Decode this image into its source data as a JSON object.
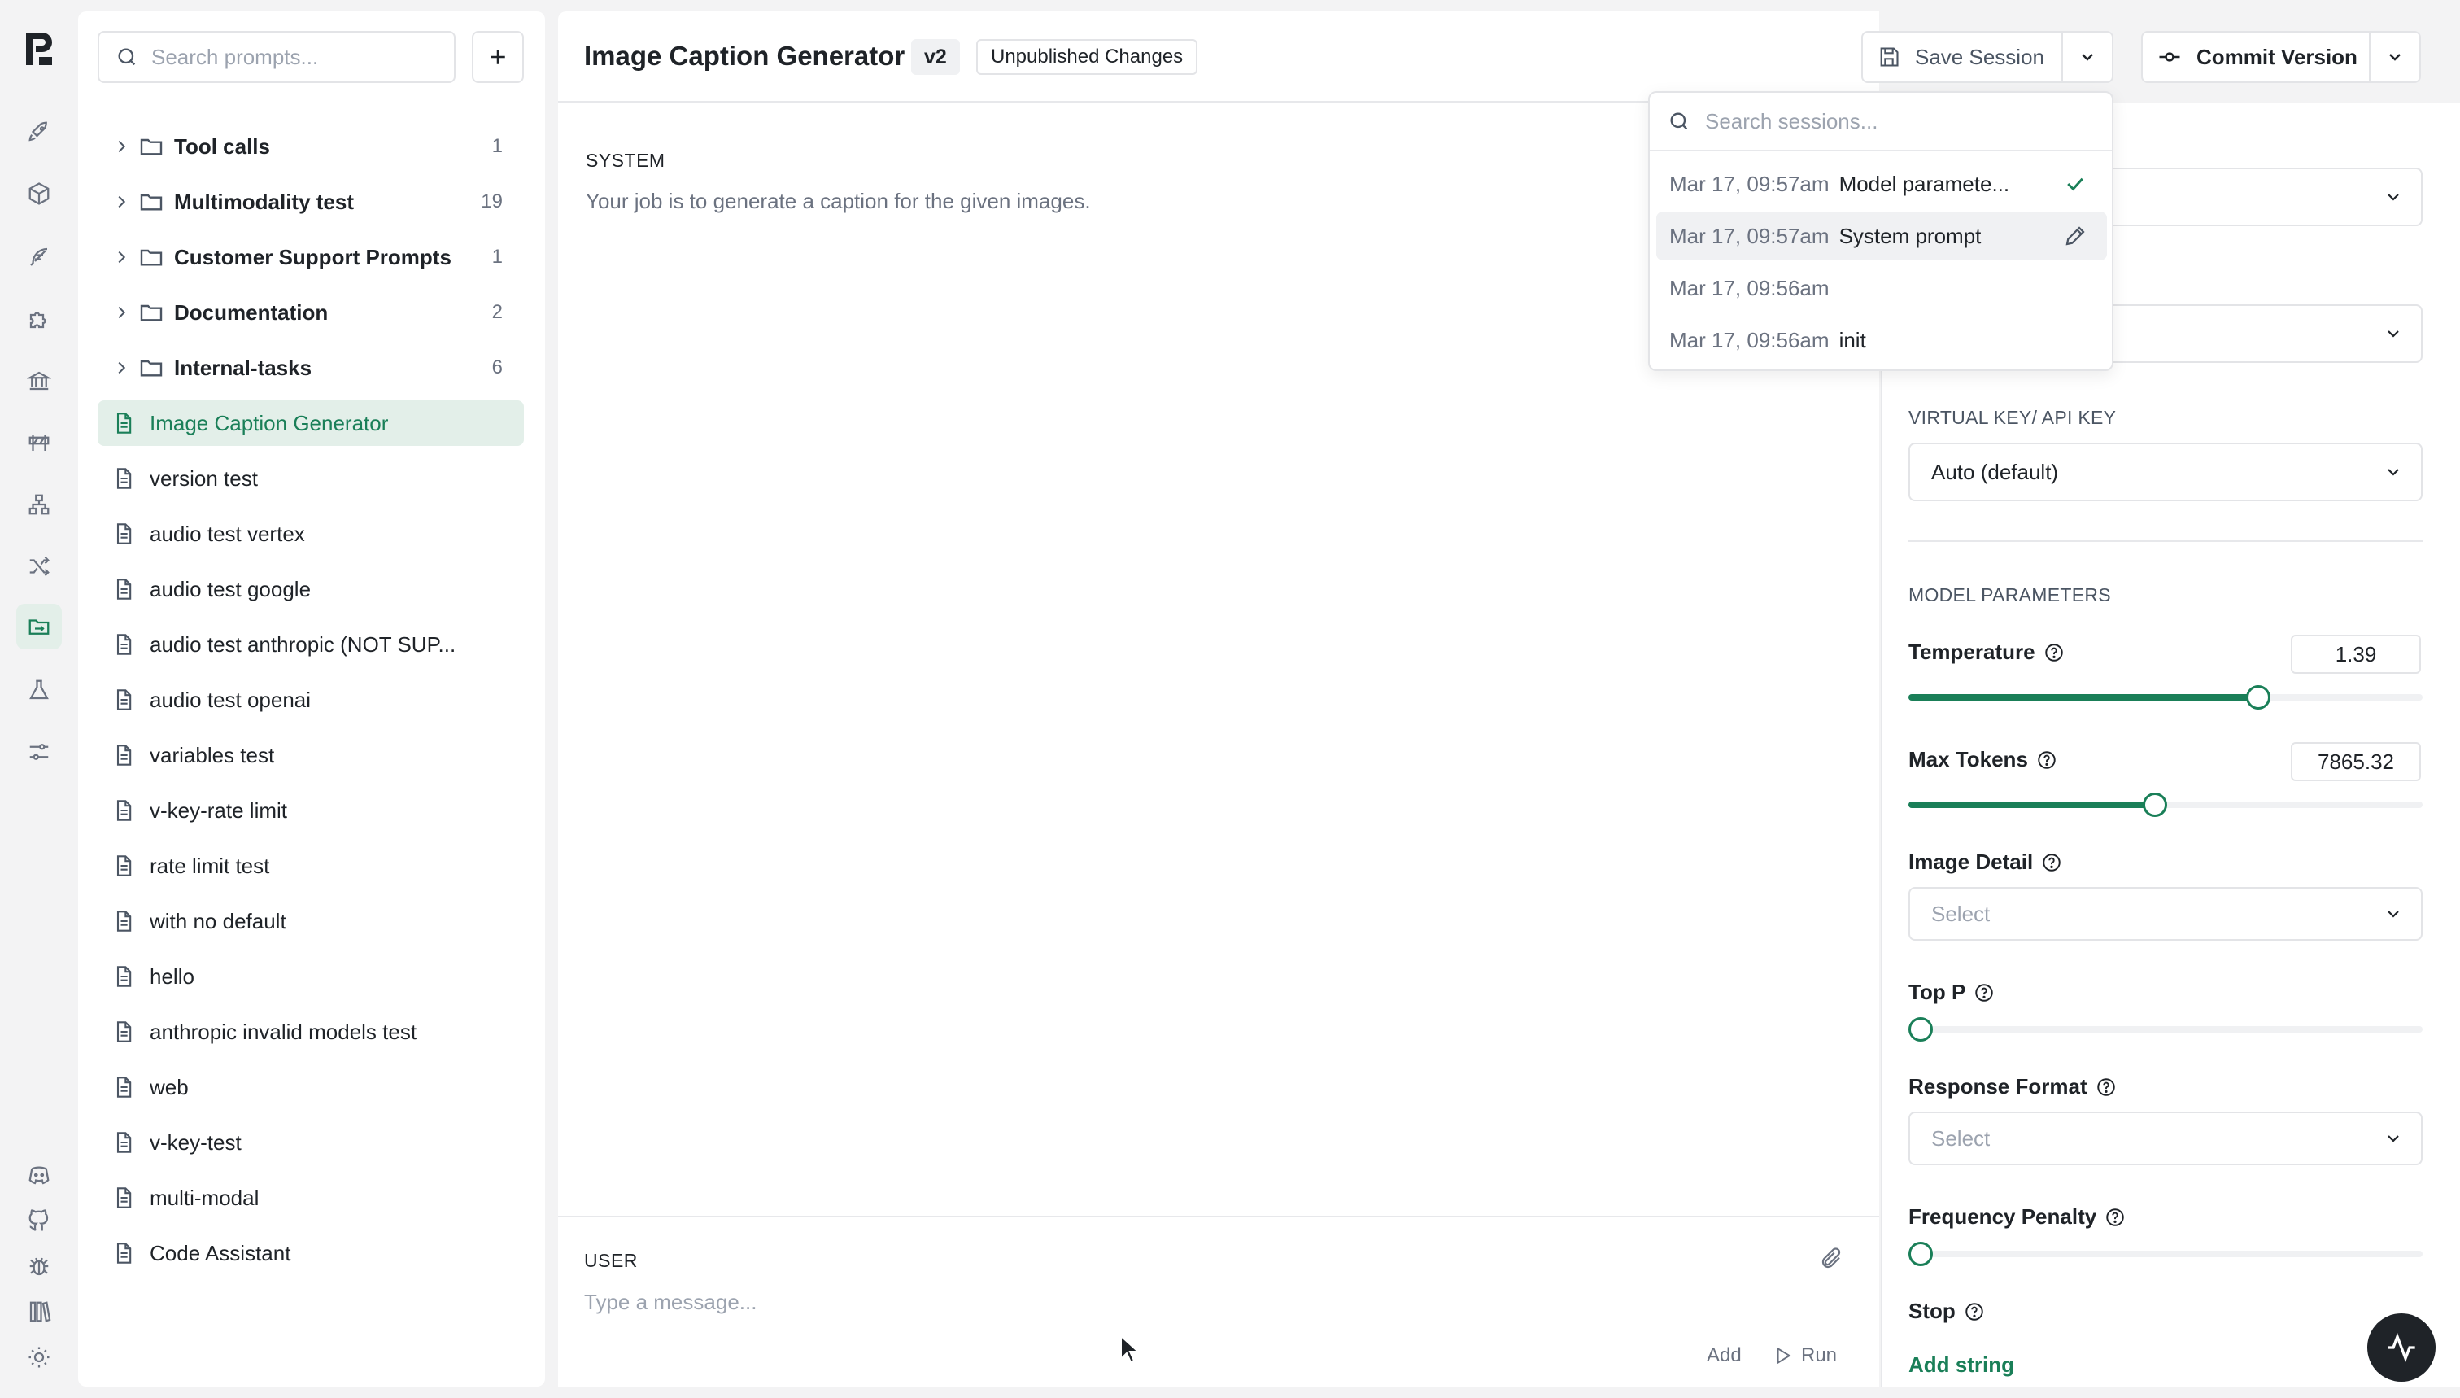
{
  "app": {
    "accent_color": "#1a7f58"
  },
  "rail": {
    "icons": [
      "rocket-icon",
      "cube-icon",
      "feather-icon",
      "puzzle-icon",
      "bank-icon",
      "road-barrier-icon",
      "sitemap-icon",
      "shuffle-icon",
      "folder-open-icon",
      "flask-icon",
      "sliders-icon",
      "discord-icon",
      "github-icon",
      "bug-icon",
      "library-icon",
      "sun-icon"
    ],
    "active": "folder-open-icon"
  },
  "prompts": {
    "search_placeholder": "Search prompts...",
    "folders": [
      {
        "name": "Tool calls",
        "count": "1"
      },
      {
        "name": "Multimodality test",
        "count": "19"
      },
      {
        "name": "Customer Support Prompts",
        "count": "1"
      },
      {
        "name": "Documentation",
        "count": "2"
      },
      {
        "name": "Internal-tasks",
        "count": "6"
      }
    ],
    "files": [
      "Image Caption Generator",
      "version test",
      "audio test vertex",
      "audio test google",
      "audio test anthropic (NOT SUP...",
      "audio test openai",
      "variables test",
      "v-key-rate limit",
      "rate limit test",
      "with no default",
      "hello",
      "anthropic invalid models test",
      "web",
      "v-key-test",
      "multi-modal",
      "Code Assistant"
    ],
    "active_file": "Image Caption Generator"
  },
  "editor": {
    "title": "Image Caption Generator",
    "version": "v2",
    "status_badge": "Unpublished Changes",
    "save_label": "Save Session",
    "commit_label": "Commit Version",
    "system_label": "SYSTEM",
    "system_text": "Your job is to generate a caption for the given images.",
    "user_label": "USER",
    "message_placeholder": "Type a message...",
    "add_label": "Add",
    "run_label": "Run"
  },
  "sessions": {
    "search_placeholder": "Search sessions...",
    "items": [
      {
        "date": "Mar 17, 09:57am",
        "name": "Model paramete...",
        "icon": "check-icon"
      },
      {
        "date": "Mar 17, 09:57am",
        "name": "System prompt",
        "icon": "pencil-icon"
      },
      {
        "date": "Mar 17, 09:56am",
        "name": ""
      },
      {
        "date": "Mar 17, 09:56am",
        "name": "init"
      }
    ]
  },
  "settings": {
    "virtual_key_label": "VIRTUAL KEY/ API KEY",
    "virtual_key_value": "Auto (default)",
    "model_params_label": "MODEL PARAMETERS",
    "temperature": {
      "label": "Temperature",
      "value": "1.39",
      "fraction": 0.68
    },
    "max_tokens": {
      "label": "Max Tokens",
      "value": "7865.32",
      "fraction": 0.48
    },
    "image_detail": {
      "label": "Image Detail",
      "placeholder": "Select"
    },
    "top_p": {
      "label": "Top P",
      "fraction": 0.0
    },
    "response_format": {
      "label": "Response Format",
      "placeholder": "Select"
    },
    "frequency_penalty": {
      "label": "Frequency Penalty",
      "fraction": 0.0
    },
    "stop": {
      "label": "Stop",
      "add_label": "Add string"
    }
  }
}
